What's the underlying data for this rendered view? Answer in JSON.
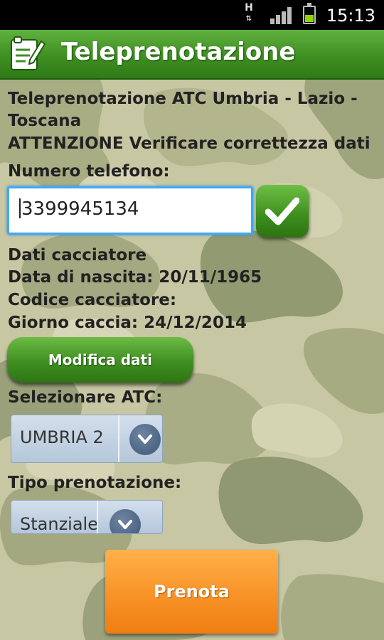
{
  "status_bar": {
    "network_label": "H",
    "time": "15:13",
    "battery_color": "#8dd400"
  },
  "header": {
    "title": "Teleprenotazione",
    "icon": "notepad-pen-icon",
    "color": "#3f8f22"
  },
  "info": {
    "line1": "Teleprenotazione ATC Umbria - Lazio -",
    "line2": "Toscana",
    "warning": "ATTENZIONE Verificare correttezza dati"
  },
  "phone": {
    "label": "Numero telefono:",
    "value": "3399945134",
    "confirm_icon": "checkmark-icon"
  },
  "hunter": {
    "heading": "Dati cacciatore",
    "birth_date": "Data di nascita: 20/11/1965",
    "code": "Codice cacciatore:",
    "hunt_day": "Giorno caccia: 24/12/2014",
    "edit_button": "Modifica dati"
  },
  "atc": {
    "label": "Selezionare ATC:",
    "selected": "UMBRIA 2"
  },
  "booking_type": {
    "label": "Tipo prenotazione:",
    "selected": "Stanziale"
  },
  "submit": {
    "label": "Prenota",
    "color": "#f9952a"
  }
}
